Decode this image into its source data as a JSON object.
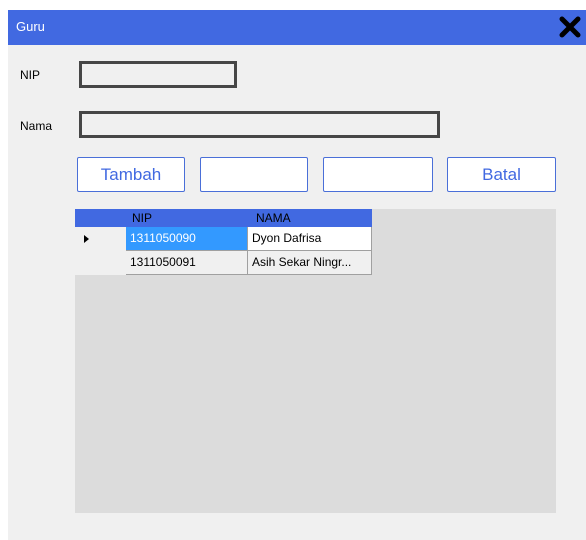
{
  "window": {
    "title": "Guru"
  },
  "form": {
    "nip_label": "NIP",
    "nip_value": "",
    "nama_label": "Nama",
    "nama_value": ""
  },
  "buttons": {
    "tambah": "Tambah",
    "button2": "",
    "button3": "",
    "batal": "Batal"
  },
  "grid": {
    "columns": [
      "NIP",
      "NAMA"
    ],
    "rows": [
      {
        "nip": "1311050090",
        "nama": "Dyon Dafrisa"
      },
      {
        "nip": "1311050091",
        "nama": "Asih Sekar Ningr..."
      }
    ]
  },
  "colors": {
    "accent": "#4169e1",
    "selection": "#3399ff",
    "grid_background": "#dcdcdc",
    "window_background": "#f0f0f0"
  },
  "icons": {
    "close": "close-x-icon",
    "row_pointer": "triangle-right-icon"
  }
}
